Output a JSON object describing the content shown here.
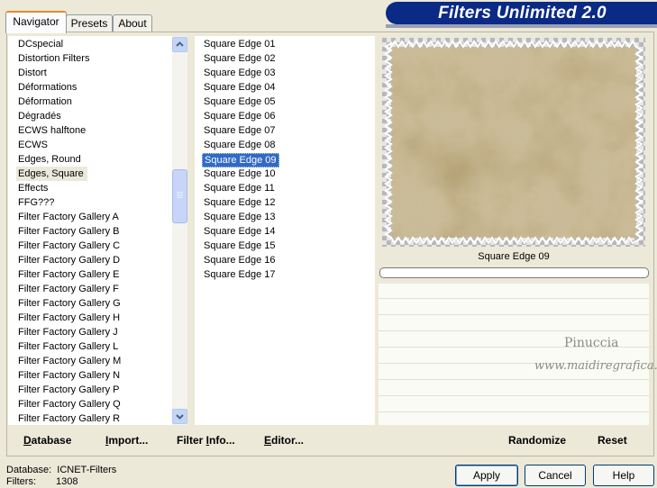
{
  "tabs": [
    {
      "label": "Navigator",
      "active": true
    },
    {
      "label": "Presets",
      "active": false
    },
    {
      "label": "About",
      "active": false
    }
  ],
  "banner": {
    "title": "Filters Unlimited 2.0"
  },
  "navigator": {
    "items": [
      "DCspecial",
      "Distortion Filters",
      "Distort",
      "Déformations",
      "Déformation",
      "Dégradés",
      "ECWS halftone",
      "ECWS",
      "Edges, Round",
      "Edges, Square",
      "Effects",
      "FFG???",
      "Filter Factory Gallery A",
      "Filter Factory Gallery B",
      "Filter Factory Gallery C",
      "Filter Factory Gallery D",
      "Filter Factory Gallery E",
      "Filter Factory Gallery F",
      "Filter Factory Gallery G",
      "Filter Factory Gallery H",
      "Filter Factory Gallery J",
      "Filter Factory Gallery L",
      "Filter Factory Gallery M",
      "Filter Factory Gallery N",
      "Filter Factory Gallery P",
      "Filter Factory Gallery Q",
      "Filter Factory Gallery R"
    ],
    "selected": "Edges, Square"
  },
  "filters": {
    "items": [
      "Square Edge 01",
      "Square Edge 02",
      "Square Edge 03",
      "Square Edge 04",
      "Square Edge 05",
      "Square Edge 06",
      "Square Edge 07",
      "Square Edge 08",
      "Square Edge 09",
      "Square Edge 10",
      "Square Edge 11",
      "Square Edge 12",
      "Square Edge 13",
      "Square Edge 14",
      "Square Edge 15",
      "Square Edge 16",
      "Square Edge 17"
    ],
    "selected": "Square Edge 09"
  },
  "preview": {
    "caption": "Square Edge 09",
    "progress": 0
  },
  "watermark": {
    "line1": "Pinuccia",
    "line2": "www.maidiregrafica.eu"
  },
  "toolbar": {
    "database": {
      "u": "D",
      "rest": "atabase"
    },
    "import": {
      "u": "I",
      "rest": "mport..."
    },
    "filter_info": {
      "pre": "Filter ",
      "u": "I",
      "rest": "nfo..."
    },
    "editor": {
      "u": "E",
      "rest": "ditor..."
    },
    "randomize": "Randomize",
    "reset": "Reset"
  },
  "status": {
    "database_label": "Database:",
    "database_value": "ICNET-Filters",
    "filters_label": "Filters:",
    "filters_value": "1308"
  },
  "buttons": {
    "apply": "Apply",
    "cancel": "Cancel",
    "help": "Help"
  },
  "colors": {
    "banner": "#0b2a86",
    "selection": "#316ac5",
    "tab_accent": "#e68b2c"
  }
}
